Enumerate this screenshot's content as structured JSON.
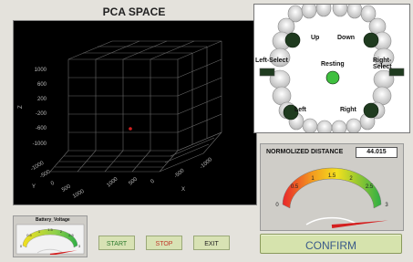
{
  "pca": {
    "title": "PCA SPACE",
    "z_axis_label": "Z",
    "x_axis_label": "X",
    "y_axis_label": "Y",
    "z_ticks": [
      "1000",
      "600",
      "200",
      "-200",
      "-600",
      "-1000"
    ],
    "x_ticks": [
      "-1000",
      "-500",
      "0",
      "500",
      "1000"
    ],
    "y_ticks": [
      "-1000",
      "-500",
      "0",
      "500",
      "1000"
    ],
    "point_color": "#d32020"
  },
  "teeth": {
    "up_label": "Up",
    "down_label": "Down",
    "left_select_label": "Left-Select",
    "right_select_label": "Right-Select",
    "resting_label": "Resting",
    "left_label": "Left",
    "right_label": "Right",
    "active_color": "#3fbf3f",
    "inactive_color": "#1f3b1f"
  },
  "distance": {
    "label": "NORMOLIZED DISTANCE",
    "value": "44.015",
    "gauge_ticks": [
      "0",
      "0.5",
      "1",
      "1.5",
      "2",
      "2.5",
      "3"
    ],
    "gauge_value": 2.9
  },
  "confirm": {
    "label": "CONFIRM"
  },
  "battery": {
    "label": "Battery_Voltage",
    "gauge_ticks": [
      "0",
      "0.5",
      "1",
      "1.5",
      "2",
      "2.5",
      "3"
    ],
    "gauge_value": 2.85
  },
  "controls": {
    "start": "START",
    "stop": "STOP",
    "exit": "EXIT"
  }
}
